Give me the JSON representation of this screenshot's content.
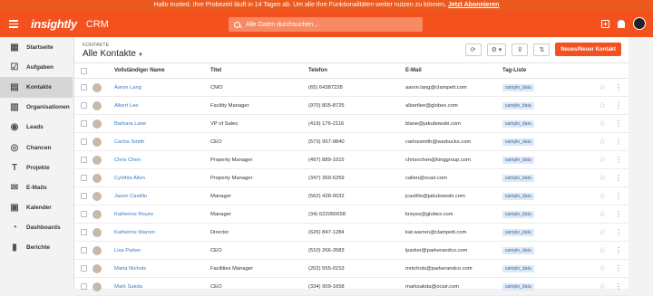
{
  "banner": {
    "text": "Hallo trusted. Ihre Probezeit läuft in 14 Tagen ab. Um alle Ihre Funktionalitäten weiter nutzen zu können, ",
    "link": "Jetzt Abonnieren"
  },
  "topbar": {
    "logo": "insightly",
    "app": "CRM",
    "search_placeholder": "Alle Daten durchsuchen..."
  },
  "sidebar": {
    "items": [
      {
        "label": "Startseite",
        "icon": "home-icon",
        "glyph": "▦"
      },
      {
        "label": "Aufgaben",
        "icon": "tasks-icon",
        "glyph": "☑"
      },
      {
        "label": "Kontakte",
        "icon": "contacts-icon",
        "glyph": "▤",
        "active": true
      },
      {
        "label": "Organisationen",
        "icon": "organisations-icon",
        "glyph": "▥"
      },
      {
        "label": "Leads",
        "icon": "leads-icon",
        "glyph": "◉"
      },
      {
        "label": "Chancen",
        "icon": "opportunities-icon",
        "glyph": "◎"
      },
      {
        "label": "Projekte",
        "icon": "projects-icon",
        "glyph": "T"
      },
      {
        "label": "E-Mails",
        "icon": "email-icon",
        "glyph": "✉"
      },
      {
        "label": "Kalender",
        "icon": "calendar-icon",
        "glyph": "▣"
      },
      {
        "label": "Dashboards",
        "icon": "dashboards-icon",
        "glyph": "◔"
      },
      {
        "label": "Berichte",
        "icon": "reports-icon",
        "glyph": "▮"
      }
    ]
  },
  "main": {
    "breadcrumb": "KONTAKTE",
    "title": "Alle Kontakte",
    "new_button": "Neues/Neuer Kontakt",
    "columns": [
      "Vollständiger Name",
      "Titel",
      "Telefon",
      "E-Mail",
      "Tag-Liste"
    ],
    "rows": [
      {
        "name": "Aaron Lang",
        "title": "CMO",
        "phone": "(65) 64387228",
        "email": "aaron.lang@clampett.com",
        "tag": "sample_data"
      },
      {
        "name": "Albert Lee",
        "title": "Facility Manager",
        "phone": "(970) 805-8725",
        "email": "albertlee@globex.com",
        "tag": "sample_data"
      },
      {
        "name": "Barbara Lane",
        "title": "VP of Sales",
        "phone": "(419) 176-2116",
        "email": "blane@jakubowski.com",
        "tag": "sample_data"
      },
      {
        "name": "Carlos Smith",
        "title": "CEO",
        "phone": "(573) 957-9840",
        "email": "carlossmith@warbucks.com",
        "tag": "sample_data"
      },
      {
        "name": "Chris Chen",
        "title": "Property Manager",
        "phone": "(497) 889-1015",
        "email": "chrisochen@kinggroup.com",
        "tag": "sample_data"
      },
      {
        "name": "Cynthia Allen",
        "title": "Property Manager",
        "phone": "(347) 369-5259",
        "email": "callen@ocair.com",
        "tag": "sample_data"
      },
      {
        "name": "Jason Castillo",
        "title": "Manager",
        "phone": "(562) 428-0032",
        "email": "jcastillo@jakubowski.com",
        "tag": "sample_data"
      },
      {
        "name": "Katherine Reyes",
        "title": "Manager",
        "phone": "(34) 622050658",
        "email": "kreyes@globex.com",
        "tag": "sample_data"
      },
      {
        "name": "Katherine Warren",
        "title": "Director",
        "phone": "(626) 847-1284",
        "email": "kat.warren@clampett.com",
        "tag": "sample_data"
      },
      {
        "name": "Lisa Parker",
        "title": "CEO",
        "phone": "(510) 266-3583",
        "email": "lparker@parkerandco.com",
        "tag": "sample_data"
      },
      {
        "name": "Maria Nichols",
        "title": "Facilities Manager",
        "phone": "(202) 555-0153",
        "email": "mnichols@parkerandco.com",
        "tag": "sample_data"
      },
      {
        "name": "Mark Sakda",
        "title": "CEO",
        "phone": "(334) 909-1658",
        "email": "marksakda@ocair.com",
        "tag": "sample_data"
      }
    ]
  },
  "colors": {
    "brand": "#f4511e",
    "link": "#3b7bbf"
  }
}
